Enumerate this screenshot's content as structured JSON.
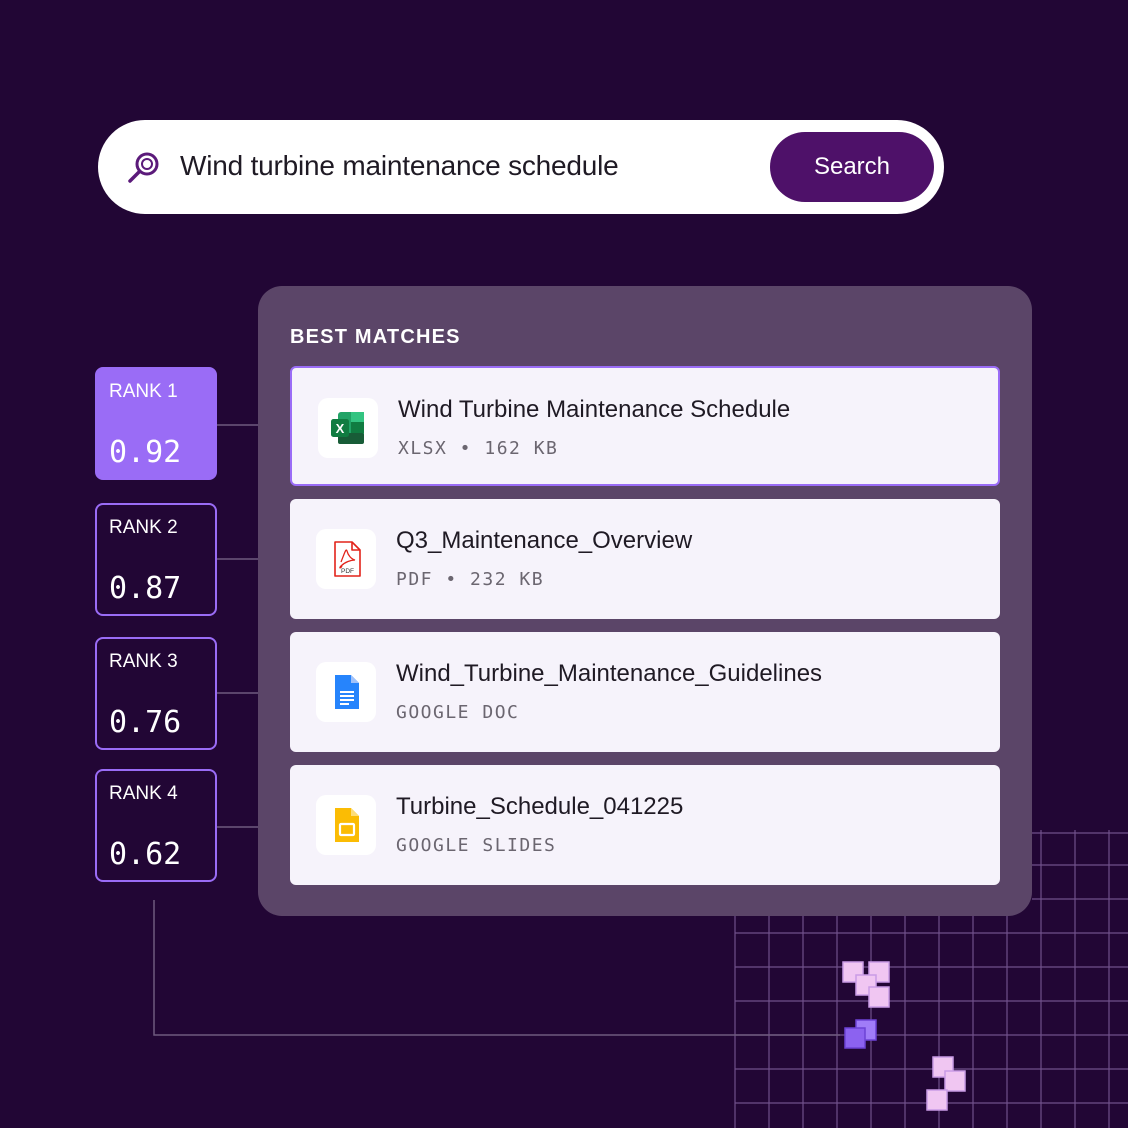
{
  "search": {
    "query": "Wind turbine maintenance schedule",
    "button_label": "Search",
    "icon": "search-icon"
  },
  "results": {
    "heading": "BEST MATCHES",
    "items": [
      {
        "name": "Wind Turbine Maintenance Schedule",
        "meta": "XLSX • 162 KB",
        "icon": "excel-icon"
      },
      {
        "name": "Q3_Maintenance_Overview",
        "meta": "PDF • 232 KB",
        "icon": "pdf-icon"
      },
      {
        "name": "Wind_Turbine_Maintenance_Guidelines",
        "meta": "GOOGLE DOC",
        "icon": "google-doc-icon"
      },
      {
        "name": "Turbine_Schedule_041225",
        "meta": "GOOGLE SLIDES",
        "icon": "google-slides-icon"
      }
    ]
  },
  "ranks": [
    {
      "label": "RANK 1",
      "score": "0.92"
    },
    {
      "label": "RANK 2",
      "score": "0.87"
    },
    {
      "label": "RANK 3",
      "score": "0.76"
    },
    {
      "label": "RANK 4",
      "score": "0.62"
    }
  ],
  "colors": {
    "background": "#220635",
    "accent": "#9a6cf6",
    "button": "#4e1169",
    "panel": "#5b4568"
  },
  "pdf_icon_text": "PDF"
}
